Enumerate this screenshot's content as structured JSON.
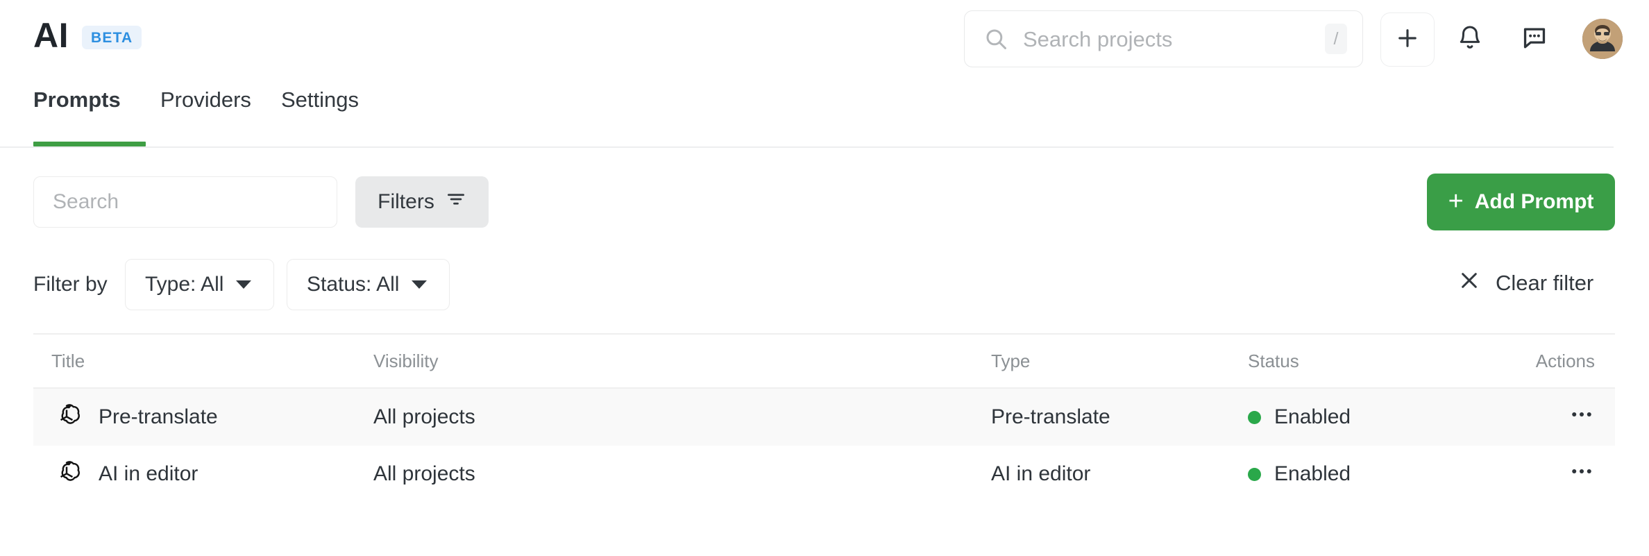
{
  "header": {
    "brand_title": "AI",
    "beta_label": "BETA",
    "search": {
      "placeholder": "Search projects",
      "shortcut_key": "/",
      "icon": "search-icon"
    },
    "actions": [
      {
        "name": "add-button",
        "icon": "plus-icon"
      },
      {
        "name": "notifications-button",
        "icon": "bell-icon"
      },
      {
        "name": "messages-button",
        "icon": "chat-bubble-icon"
      },
      {
        "name": "user-avatar",
        "icon": "avatar-icon"
      }
    ]
  },
  "tabs": [
    {
      "label": "Prompts",
      "active": true
    },
    {
      "label": "Providers",
      "active": false
    },
    {
      "label": "Settings",
      "active": false
    }
  ],
  "toolbar": {
    "search_placeholder": "Search",
    "filters_label": "Filters",
    "filters_icon": "filter-icon",
    "add_prompt_label": "Add Prompt",
    "add_prompt_plus": "+"
  },
  "filter_bar": {
    "filter_by_label": "Filter by",
    "type_dropdown": "Type: All",
    "status_dropdown": "Status: All",
    "clear_filter_label": "Clear filter",
    "clear_filter_icon": "close-icon"
  },
  "table": {
    "columns": {
      "title": "Title",
      "visibility": "Visibility",
      "type": "Type",
      "status": "Status",
      "actions": "Actions"
    },
    "rows": [
      {
        "icon": "openai-logo-icon",
        "title": "Pre-translate",
        "visibility": "All projects",
        "type": "Pre-translate",
        "status": "Enabled",
        "actions_icon": "more-options-icon"
      },
      {
        "icon": "openai-logo-icon",
        "title": "AI in editor",
        "visibility": "All projects",
        "type": "AI in editor",
        "status": "Enabled",
        "actions_icon": "more-options-icon"
      }
    ]
  },
  "colors": {
    "accent_green": "#3a9e47",
    "status_green": "#2aa84a",
    "beta_blue": "#2d8fe0",
    "beta_bg": "#eaf2fb",
    "row_shaded": "#f9f9f9",
    "text_dark": "#2e343a",
    "text_muted": "#8b9094"
  }
}
